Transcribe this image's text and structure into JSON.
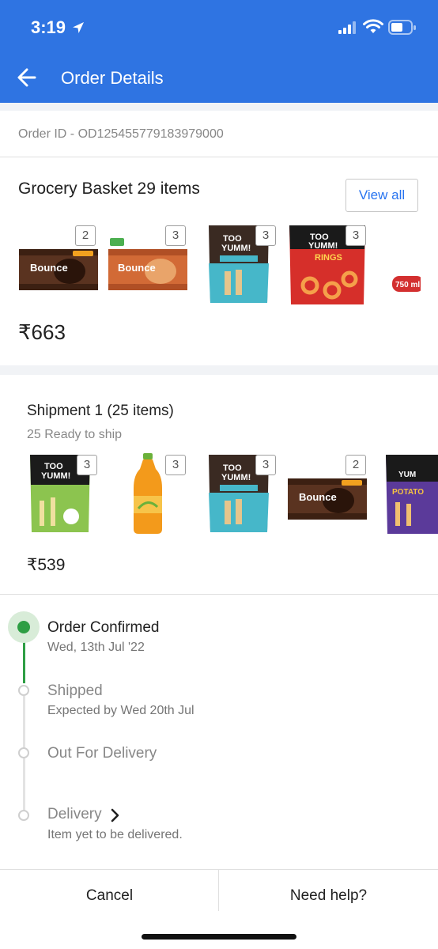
{
  "status_bar": {
    "time": "3:19"
  },
  "header": {
    "title": "Order Details"
  },
  "order": {
    "id_text": "Order ID - OD125455779183979000"
  },
  "basket": {
    "title": "Grocery Basket 29 items",
    "view_all_label": "View all",
    "price": "₹663",
    "items": [
      {
        "name": "Bounce Choco Creme biscuit",
        "qty": "2",
        "colors": {
          "primary": "#5a3320",
          "accent": "#f2a11f"
        }
      },
      {
        "name": "Bounce Orange Creme biscuit",
        "qty": "3",
        "colors": {
          "primary": "#d26a36",
          "accent": "#ffffff"
        }
      },
      {
        "name": "Too Yumm Multigrain Chips",
        "qty": "3",
        "colors": {
          "primary": "#46b7c9",
          "accent": "#3a2a22"
        }
      },
      {
        "name": "Too Yumm Rings",
        "qty": "3",
        "colors": {
          "primary": "#d62f2a",
          "accent": "#1a1a1a"
        }
      }
    ],
    "partial_badge": "750 ml"
  },
  "shipment": {
    "title": "Shipment 1 (25 items)",
    "status": "25 Ready to ship",
    "price": "₹539",
    "items": [
      {
        "name": "Too Yumm Veggie Stix",
        "qty": "3",
        "colors": {
          "primary": "#8cc44f",
          "accent": "#1b1b1b"
        }
      },
      {
        "name": "Mango drink bottle",
        "qty": "3",
        "colors": {
          "primary": "#f39a1b",
          "accent": "#6bb13a"
        }
      },
      {
        "name": "Too Yumm Multigrain Chips",
        "qty": "3",
        "colors": {
          "primary": "#46b7c9",
          "accent": "#3a2a22"
        }
      },
      {
        "name": "Bounce Choco Creme biscuit",
        "qty": "2",
        "colors": {
          "primary": "#5a3320",
          "accent": "#f2a11f"
        }
      }
    ]
  },
  "tracking": {
    "steps": [
      {
        "title": "Order Confirmed",
        "subtitle": "Wed, 13th Jul '22",
        "done": true
      },
      {
        "title": "Shipped",
        "subtitle": "Expected by Wed 20th Jul",
        "done": false
      },
      {
        "title": "Out For Delivery",
        "subtitle": "",
        "done": false
      },
      {
        "title": "Delivery",
        "subtitle": "Item yet to be delivered.",
        "done": false
      }
    ]
  },
  "footer": {
    "cancel_label": "Cancel",
    "help_label": "Need help?"
  },
  "colors": {
    "brand": "#2f74e2",
    "link": "#2874f0",
    "success": "#2e9e44"
  }
}
